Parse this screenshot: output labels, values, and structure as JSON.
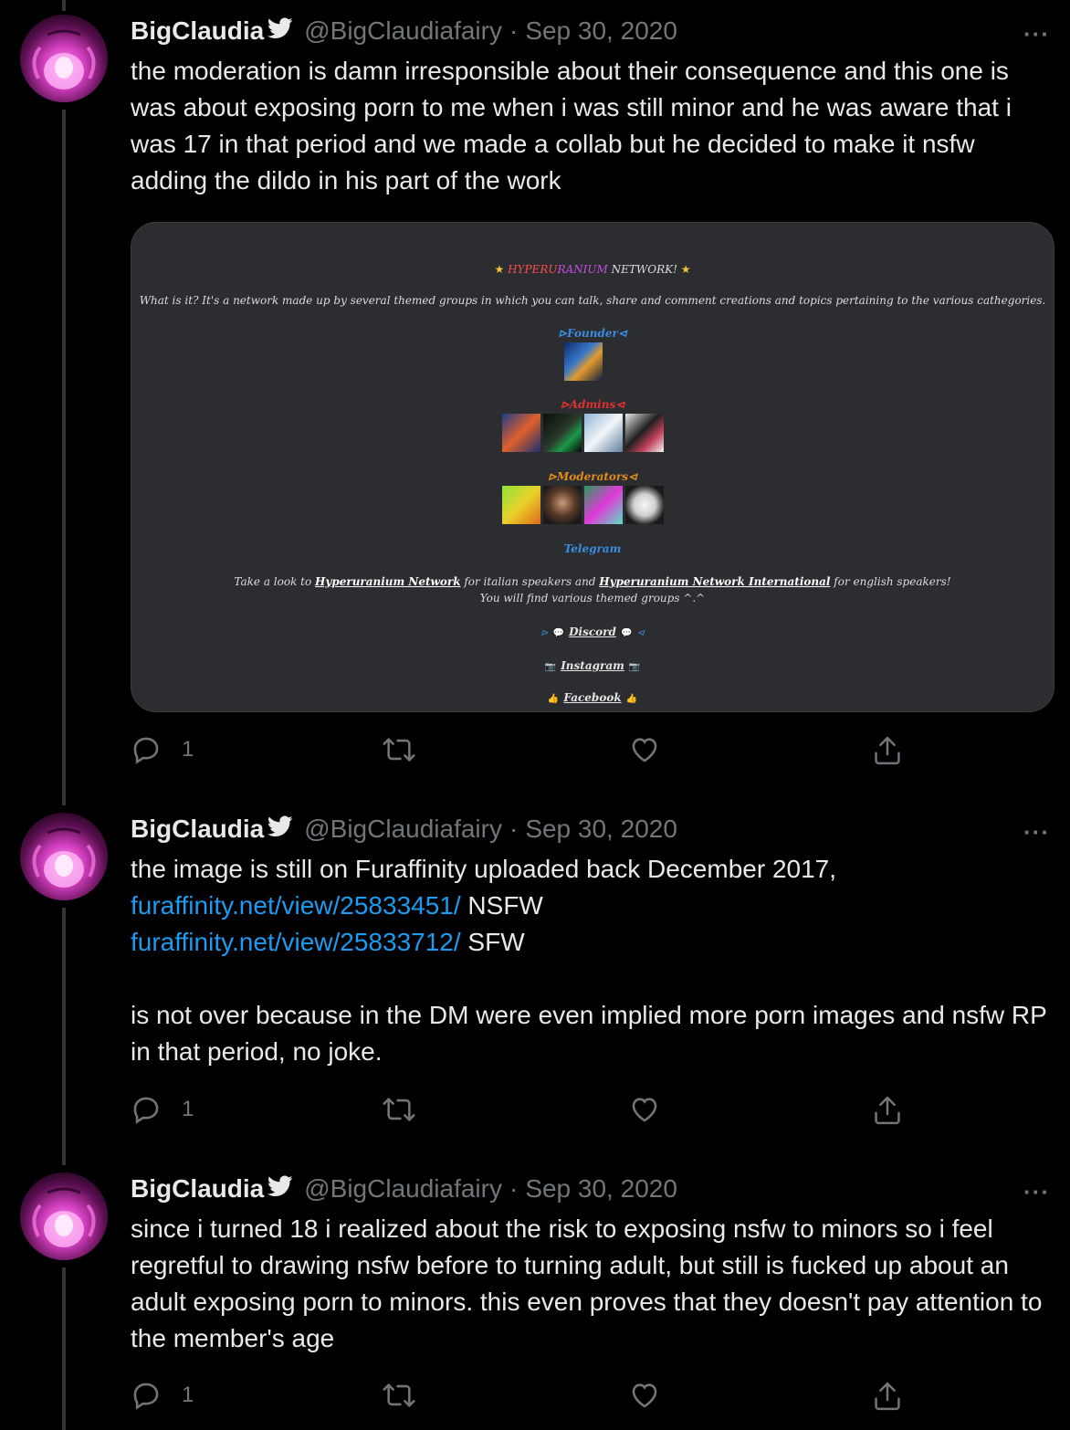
{
  "tweets": [
    {
      "name": "BigClaudia",
      "handle": "@BigClaudiafairy",
      "separator": "·",
      "date": "Sep 30, 2020",
      "more": "···",
      "text": "the moderation is damn irresponsible about their consequence and this one is was about exposing porn to me when i was still minor and he was aware that i was 17 in that period and we made a collab but he decided to make it nsfw adding the dildo in his part of the work",
      "reply_count": "1",
      "card": {
        "title_pre": "HYPERU",
        "title_mid": "RANIUM",
        "title_post": " NETWORK!",
        "star": "★",
        "description": "What is it? It's a network made up by several themed groups in which you can talk, share and comment creations and topics pertaining to the various cathegories.",
        "founder_label": "⊳Founder⊲",
        "admins_label": "⊳Admins⊲",
        "moderators_label": "⊳Moderators⊲",
        "telegram_label": "Telegram",
        "look_pre": "Take a look to ",
        "look_link1": "Hyperuranium Network",
        "look_mid": " for italian speakers and ",
        "look_link2": "Hyperuranium Network International",
        "look_post": " for english speakers!",
        "look_line2": "You will find various themed groups ^.^",
        "discord_label": "Discord",
        "instagram_label": "Instagram",
        "facebook_label": "Facebook"
      }
    },
    {
      "name": "BigClaudia",
      "handle": "@BigClaudiafairy",
      "separator": "·",
      "date": "Sep 30, 2020",
      "more": "···",
      "line1": "the image is still on Furaffinity uploaded back December 2017,",
      "link1": "furaffinity.net/view/25833451/",
      "link1_suffix": " NSFW",
      "link2": "furaffinity.net/view/25833712/",
      "link2_suffix": " SFW",
      "para2": "is not over because in the DM were even implied more porn images and nsfw RP in that period, no joke.",
      "reply_count": "1"
    },
    {
      "name": "BigClaudia",
      "handle": "@BigClaudiafairy",
      "separator": "·",
      "date": "Sep 30, 2020",
      "more": "···",
      "text": "since i turned 18 i realized about the risk to exposing nsfw to minors so i feel regretful to drawing nsfw before to turning adult, but still is fucked up about an adult exposing porn to minors. this even proves that they doesn't pay attention to the member's age",
      "reply_count": "1"
    }
  ],
  "colors": {
    "background": "#000000",
    "text": "#e7e9ea",
    "secondary": "#71767b",
    "link": "#1d9bf0",
    "thread_line": "#333639"
  }
}
